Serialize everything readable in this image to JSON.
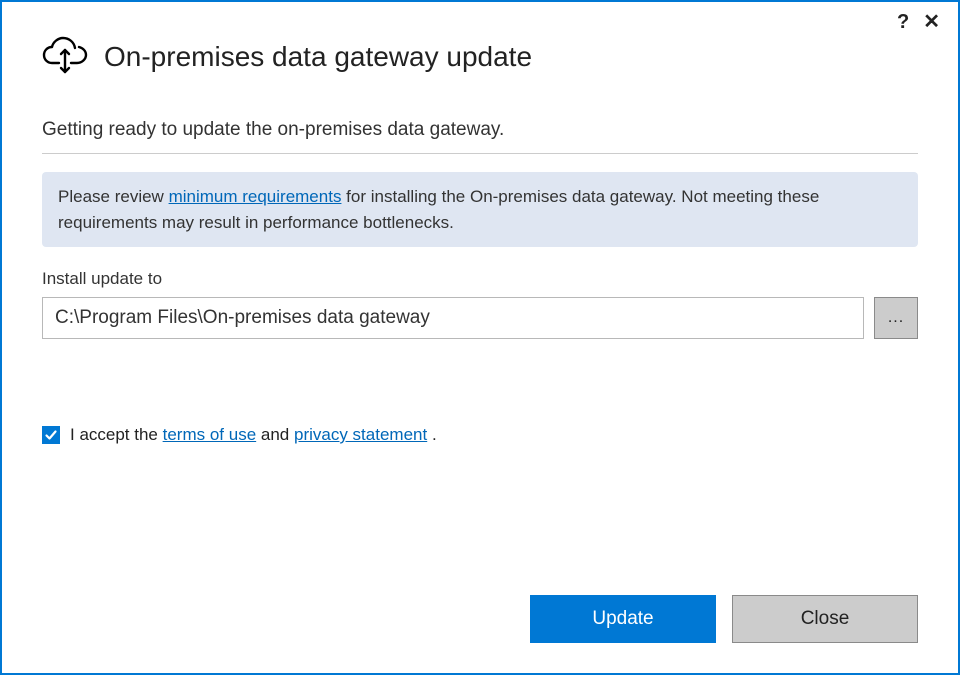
{
  "header": {
    "title": "On-premises data gateway update"
  },
  "subtitle": "Getting ready to update the on-premises data gateway.",
  "info": {
    "pre": "Please review ",
    "link": "minimum requirements",
    "post": " for installing the On-premises data gateway. Not meeting these requirements may result in performance bottlenecks."
  },
  "install": {
    "label": "Install update to",
    "path": "C:\\Program Files\\On-premises data gateway",
    "browse": "..."
  },
  "accept": {
    "checked": true,
    "pre": "I accept the ",
    "terms": "terms of use",
    "mid": " and ",
    "privacy": "privacy statement",
    "post": " ."
  },
  "footer": {
    "update": "Update",
    "close": "Close"
  },
  "titlebar": {
    "help": "?",
    "close": "✕"
  }
}
